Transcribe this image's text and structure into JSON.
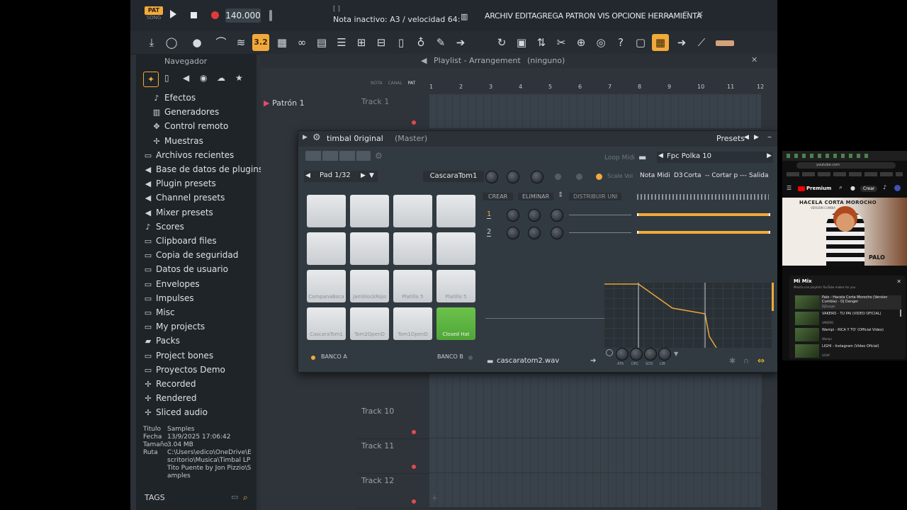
{
  "app": {
    "mode_pat": "PAT",
    "mode_song": "SONG",
    "tempo": "140.000",
    "status_bracket": "[ ]",
    "status_text": "Nota inactivo: A3 / velocidad 64:",
    "menu": "ARCHIV EDITAGREGA PATRON VIS OPCIONE HERRAMIENTA"
  },
  "toolbar": {
    "active_label": "3.2",
    "icons": [
      "download-icon",
      "metronome-icon",
      "knob-icon",
      "shape-icon",
      "wave-icon",
      "step-icon",
      "piano-icon",
      "loop-icon",
      "mixer-icon",
      "channel-rack-icon",
      "plugin-icon",
      "browser-icon",
      "plug-icon",
      "brush-icon",
      "arrow-icon",
      "cycle-icon",
      "save-icon",
      "export-icon",
      "cut-icon",
      "mic-icon",
      "chat-icon",
      "help-icon",
      "window-icon",
      "grid-icon",
      "next-icon",
      "pen-icon",
      "color-icon"
    ]
  },
  "navigator": {
    "title": "Navegador",
    "items": [
      {
        "icon": "fx-icon",
        "label": "Efectos"
      },
      {
        "icon": "piano-icon",
        "label": "Generadores"
      },
      {
        "icon": "remote-icon",
        "label": "Control remoto"
      },
      {
        "icon": "wave-icon",
        "label": "Muestras"
      },
      {
        "icon": "folder-icon",
        "label": "Archivos recientes"
      },
      {
        "icon": "plugin-icon",
        "label": "Base de datos de plugins"
      },
      {
        "icon": "plugin-icon",
        "label": "Plugin presets"
      },
      {
        "icon": "plugin-icon",
        "label": "Channel presets"
      },
      {
        "icon": "plugin-icon",
        "label": "Mixer presets"
      },
      {
        "icon": "note-icon",
        "label": "Scores"
      },
      {
        "icon": "folder-icon",
        "label": "Clipboard files"
      },
      {
        "icon": "folder-icon",
        "label": "Copia de seguridad"
      },
      {
        "icon": "folder-icon",
        "label": "Datos de usuario"
      },
      {
        "icon": "folder-icon",
        "label": "Envelopes"
      },
      {
        "icon": "folder-icon",
        "label": "Impulses"
      },
      {
        "icon": "folder-icon",
        "label": "Misc"
      },
      {
        "icon": "folder-icon",
        "label": "My projects"
      },
      {
        "icon": "pack-icon",
        "label": "Packs"
      },
      {
        "icon": "folder-icon",
        "label": "Project bones"
      },
      {
        "icon": "folder-icon",
        "label": "Proyectos Demo"
      },
      {
        "icon": "wave-icon",
        "label": "Recorded"
      },
      {
        "icon": "wave-icon",
        "label": "Rendered"
      },
      {
        "icon": "wave-icon",
        "label": "Sliced audio"
      }
    ],
    "info": {
      "titulo_k": "Titulo",
      "titulo_v": "Samples",
      "fecha_k": "Fecha",
      "fecha_v": "13/9/2025 17:06:42",
      "tamano_k": "Tamaño",
      "tamano_v": "3.04 MB",
      "ruta_k": "Ruta",
      "ruta_v": "C:\\Users\\edico\\OneDrive\\Escritorio\\Musica\\Timbal LP Tito Puente by Jon Pizzio\\Samples"
    },
    "tags_label": "TAGS"
  },
  "playlist": {
    "title": "Playlist - Arrangement",
    "subtitle": "(ninguno)",
    "pattern": "Patrón 1",
    "track_top": "Track 1",
    "tracks": [
      "Track 10",
      "Track 11",
      "Track 12"
    ],
    "ruler": [
      "1",
      "2",
      "3",
      "4",
      "5",
      "6",
      "7",
      "8",
      "9",
      "10",
      "11",
      "12"
    ],
    "tabs": [
      "NOTA",
      "CANAL",
      "PAT"
    ]
  },
  "fpc": {
    "title": "timbal 0riginal",
    "subtitle": "(Master)",
    "presets_label": "Presets",
    "loop_midi": "Loop Midi",
    "preset_name": "Fpc Polka 10",
    "pad_label": "Pad 1/32",
    "pad_name": "CascaraTom1",
    "scale_vol": "Scale Vol",
    "nota_midi": "Nota Midi",
    "nota_value": "D3",
    "corta": "Corta",
    "cortar_p": "-- Cortar p ---",
    "salida": "Salida",
    "crear": "CREAR",
    "eliminar": "ELIMINAR",
    "distribuir": "DISTRIBUIR UNI",
    "layers": [
      "1",
      "2"
    ],
    "pads": [
      {
        "label": ""
      },
      {
        "label": ""
      },
      {
        "label": ""
      },
      {
        "label": ""
      },
      {
        "label": ""
      },
      {
        "label": ""
      },
      {
        "label": ""
      },
      {
        "label": ""
      },
      {
        "label": "CampanaBoca"
      },
      {
        "label": "JamblockRojo"
      },
      {
        "label": "Platillo 5"
      },
      {
        "label": "Platillo 5"
      },
      {
        "label": "CascaraTom1"
      },
      {
        "label": "Tom2OpenD"
      },
      {
        "label": "Tom1OpenD"
      },
      {
        "label": "Closed Hat"
      }
    ],
    "banco_a": "BANCO A",
    "banco_b": "BANCO B",
    "sample_file": "cascaratom2.wav",
    "env_knobs": [
      "ATA",
      "DEC",
      "SOS",
      "LIB"
    ],
    "accent": "#f2a93b",
    "active_pad_color": "#6cc24a"
  },
  "youtube": {
    "badge": "Premium",
    "create": "Crear",
    "url": "youtube.com",
    "video_title": "HACELA CORTA MOROCHO",
    "video_sub": "VERSION CUMBIA",
    "video_brand": "PALO",
    "mix_title": "Mi Mix",
    "mix_sub": "Mezcla con playlists YouTube makes for you",
    "items": [
      {
        "title": "Palo - Hacela Corta Morocho (Version Cumbia) - Dj Danger",
        "channel": "DjDanger"
      },
      {
        "title": "VAKERO - TU PAI (VIDEO OFICIAL)",
        "channel": "VAKERO"
      },
      {
        "title": "Wampi - RICA Y TO' (Official Video)",
        "channel": "Wampi"
      },
      {
        "title": "LIGHI - Instagram (Video Oficial)",
        "channel": "LIGHI"
      }
    ]
  }
}
